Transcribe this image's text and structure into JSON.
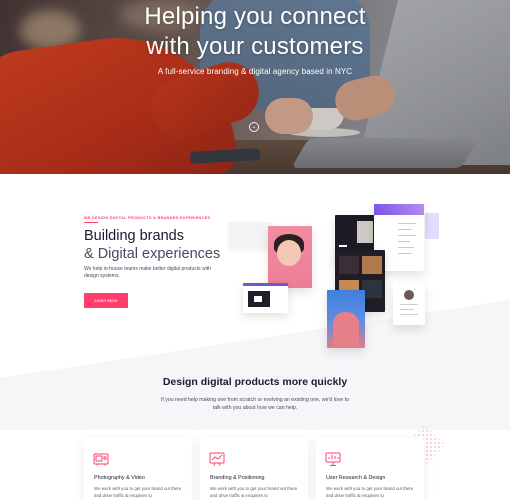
{
  "hero": {
    "title_line1": "Helping you connect",
    "title_line2": "with your customers",
    "subtitle": "A full-service branding & digital agency based in NYC",
    "scroll_icon": "chevron-down-icon"
  },
  "brand": {
    "eyebrow": "WE DESIGN DIGITAL PRODUCTS & BRANDED EXPERIENCES",
    "title_line1": "Building brands",
    "title_line2": "& Digital experiences",
    "description": "We help in-house teams make better digital products with design systems.",
    "cta_label": "Learn More"
  },
  "design": {
    "title": "Design digital products more quickly",
    "description": "If you need help making one from scratch or evolving an existing one, we'd love to talk with you about how we can help."
  },
  "cards": [
    {
      "title": "Photography & Video",
      "icon": "camera-video-icon",
      "description": "We work with you to get your brand out there and drive traffic & enquiries to"
    },
    {
      "title": "Branding & Positioning",
      "icon": "chart-board-icon",
      "description": "We work with you to get your brand out there and drive traffic & enquiries to"
    },
    {
      "title": "User Research & Design",
      "icon": "presentation-icon",
      "description": "We work with you to get your brand out there and drive traffic & enquiries to"
    }
  ],
  "colors": {
    "accent": "#ff3e6c",
    "heading": "#1b1a2e",
    "hero_text": "#ffffff"
  }
}
